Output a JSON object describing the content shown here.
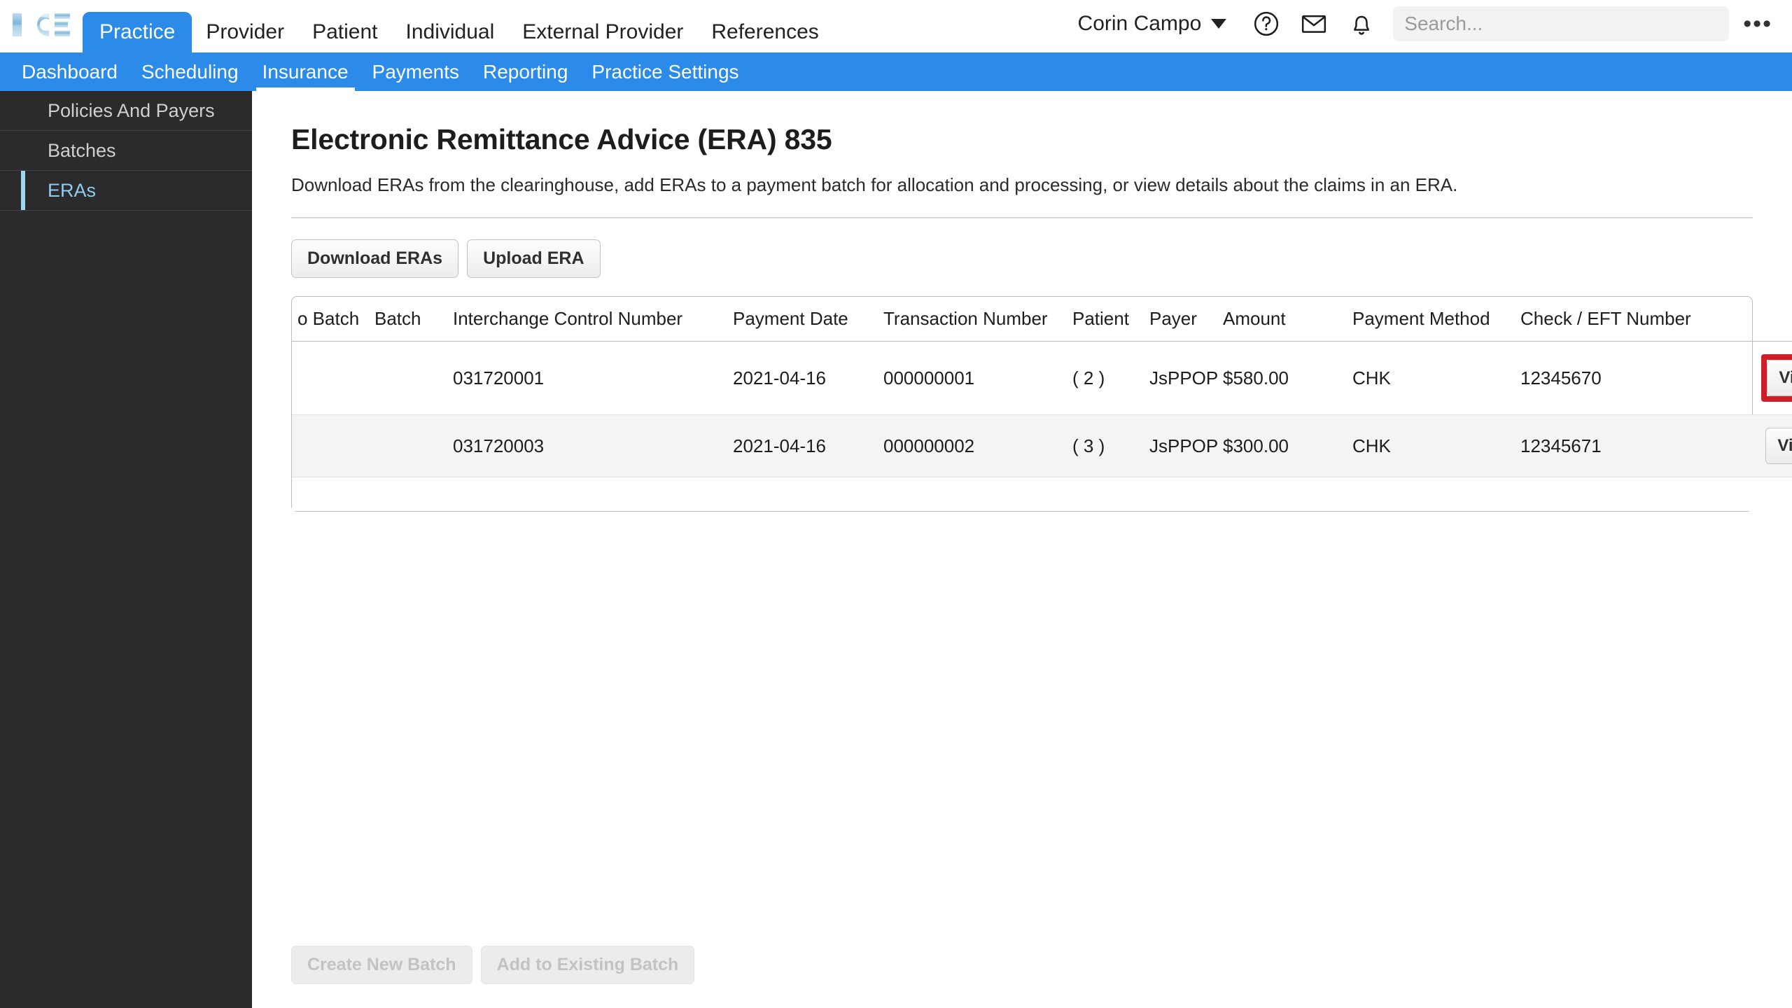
{
  "brand": {
    "logo_text": "ICE",
    "accent": "#2c8ae8"
  },
  "topbar": {
    "tabs": [
      {
        "label": "Practice",
        "active": true
      },
      {
        "label": "Provider",
        "active": false
      },
      {
        "label": "Patient",
        "active": false
      },
      {
        "label": "Individual",
        "active": false
      },
      {
        "label": "External Provider",
        "active": false
      },
      {
        "label": "References",
        "active": false
      }
    ],
    "user_name": "Corin Campo",
    "icons": [
      "help-icon",
      "mail-icon",
      "bell-icon"
    ],
    "search": {
      "value": "",
      "placeholder": "Search..."
    },
    "overflow_label": "•••"
  },
  "bluenav": {
    "items": [
      {
        "label": "Dashboard",
        "active": false
      },
      {
        "label": "Scheduling",
        "active": false
      },
      {
        "label": "Insurance",
        "active": true
      },
      {
        "label": "Payments",
        "active": false
      },
      {
        "label": "Reporting",
        "active": false
      },
      {
        "label": "Practice Settings",
        "active": false
      }
    ]
  },
  "sidebar": {
    "items": [
      {
        "label": "Policies And Payers",
        "active": false
      },
      {
        "label": "Batches",
        "active": false
      },
      {
        "label": "ERAs",
        "active": true
      }
    ]
  },
  "main": {
    "title": "Electronic Remittance Advice (ERA) 835",
    "description": "Download ERAs from the clearinghouse, add ERAs to a payment batch for allocation and processing, or view details about the claims in an ERA.",
    "toolbar": {
      "download_label": "Download ERAs",
      "upload_label": "Upload ERA"
    },
    "table": {
      "headers": [
        "o Batch",
        "Batch",
        "Interchange Control Number",
        "Payment Date",
        "Transaction Number",
        "Patient",
        "Payer",
        "Amount",
        "Payment Method",
        "Check / EFT Number",
        ""
      ],
      "rows": [
        {
          "add_to_batch": "",
          "batch": "",
          "interchange_control_number": "031720001",
          "payment_date": "2021-04-16",
          "transaction_number": "000000001",
          "patient": "( 2 )",
          "payer": "JsPPOP",
          "amount": "$580.00",
          "payment_method": "CHK",
          "check_eft_number": "12345670",
          "action_label": "View Claims",
          "highlighted": true
        },
        {
          "add_to_batch": "",
          "batch": "",
          "interchange_control_number": "031720003",
          "payment_date": "2021-04-16",
          "transaction_number": "000000002",
          "patient": "( 3 )",
          "payer": "JsPPOP",
          "amount": "$300.00",
          "payment_method": "CHK",
          "check_eft_number": "12345671",
          "action_label": "View Claims",
          "highlighted": false
        }
      ]
    },
    "footer": {
      "create_batch_label": "Create New Batch",
      "add_existing_batch_label": "Add to Existing Batch"
    }
  },
  "colors": {
    "nav_blue": "#2c8ae8",
    "sidebar_bg": "#2b2b2b",
    "sidebar_active_text": "#8dcdf0",
    "highlight_red": "#cc1f2a"
  }
}
